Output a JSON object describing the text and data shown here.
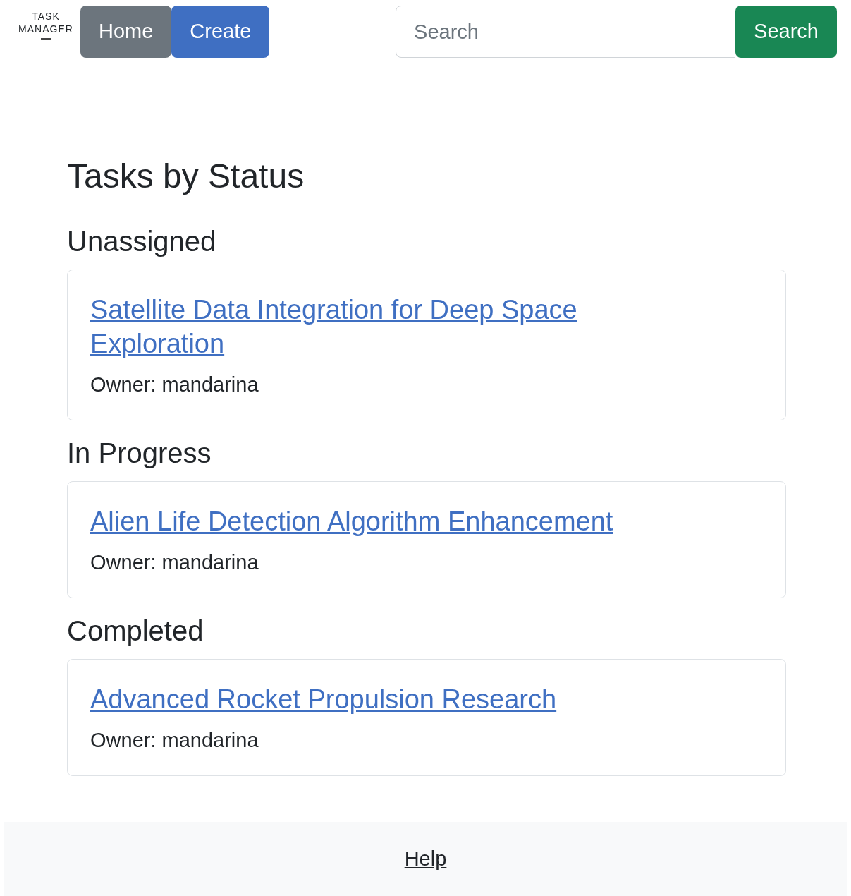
{
  "logo": {
    "line_1": "TASK",
    "line_2": "MANAGER"
  },
  "nav": [
    {
      "label": "Home",
      "kind": "secondary"
    },
    {
      "label": "Create",
      "kind": "primary"
    }
  ],
  "search": {
    "placeholder": "Search",
    "button": "Search"
  },
  "title": "Tasks by Status",
  "groups": [
    {
      "heading": "Unassigned",
      "tasks": [
        {
          "title": "Satellite Data Integration for Deep Space Exploration",
          "owner": "Owner: mandarina"
        }
      ]
    },
    {
      "heading": "In Progress",
      "tasks": [
        {
          "title": "Alien Life Detection Algorithm Enhancement",
          "owner": "Owner: mandarina"
        }
      ]
    },
    {
      "heading": "Completed",
      "tasks": [
        {
          "title": "Advanced Rocket Propulsion Research",
          "owner": "Owner: mandarina"
        }
      ]
    }
  ],
  "footer": {
    "link": "Help"
  }
}
